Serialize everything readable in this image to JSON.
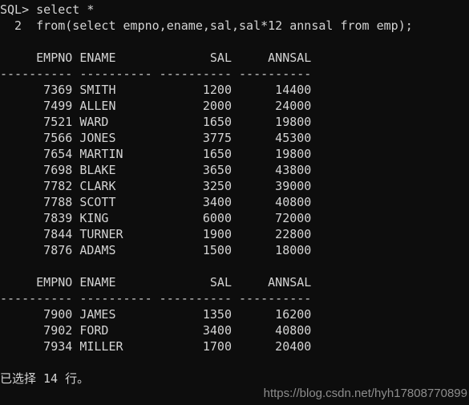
{
  "terminal": {
    "background_color": "#0d0d0d",
    "text_color": "#d4d4d4",
    "prompt_lines": [
      "SQL> select *",
      "  2  from(select empno,ename,sal,sal*12 annsal from emp);"
    ],
    "blank_after_prompt": "",
    "result_blocks": [
      {
        "header": "     EMPNO ENAME             SAL     ANNSAL",
        "separator": "---------- ---------- ---------- ----------",
        "rows": [
          "      7369 SMITH            1200      14400",
          "      7499 ALLEN            2000      24000",
          "      7521 WARD             1650      19800",
          "      7566 JONES            3775      45300",
          "      7654 MARTIN           1650      19800",
          "      7698 BLAKE            3650      43800",
          "      7782 CLARK            3250      39000",
          "      7788 SCOTT            3400      40800",
          "      7839 KING             6000      72000",
          "      7844 TURNER           1900      22800",
          "      7876 ADAMS            1500      18000"
        ]
      },
      {
        "header": "     EMPNO ENAME             SAL     ANNSAL",
        "separator": "---------- ---------- ---------- ----------",
        "rows": [
          "      7900 JAMES            1350      16200",
          "      7902 FORD             3400      40800",
          "      7934 MILLER           1700      20400"
        ]
      }
    ],
    "footer": "已选择 14 行。",
    "watermark": "https://blog.csdn.net/hyh17808770899"
  },
  "table_data": {
    "columns": [
      "EMPNO",
      "ENAME",
      "SAL",
      "ANNSAL"
    ],
    "rows": [
      {
        "EMPNO": 7369,
        "ENAME": "SMITH",
        "SAL": 1200,
        "ANNSAL": 14400
      },
      {
        "EMPNO": 7499,
        "ENAME": "ALLEN",
        "SAL": 2000,
        "ANNSAL": 24000
      },
      {
        "EMPNO": 7521,
        "ENAME": "WARD",
        "SAL": 1650,
        "ANNSAL": 19800
      },
      {
        "EMPNO": 7566,
        "ENAME": "JONES",
        "SAL": 3775,
        "ANNSAL": 45300
      },
      {
        "EMPNO": 7654,
        "ENAME": "MARTIN",
        "SAL": 1650,
        "ANNSAL": 19800
      },
      {
        "EMPNO": 7698,
        "ENAME": "BLAKE",
        "SAL": 3650,
        "ANNSAL": 43800
      },
      {
        "EMPNO": 7782,
        "ENAME": "CLARK",
        "SAL": 3250,
        "ANNSAL": 39000
      },
      {
        "EMPNO": 7788,
        "ENAME": "SCOTT",
        "SAL": 3400,
        "ANNSAL": 40800
      },
      {
        "EMPNO": 7839,
        "ENAME": "KING",
        "SAL": 6000,
        "ANNSAL": 72000
      },
      {
        "EMPNO": 7844,
        "ENAME": "TURNER",
        "SAL": 1900,
        "ANNSAL": 22800
      },
      {
        "EMPNO": 7876,
        "ENAME": "ADAMS",
        "SAL": 1500,
        "ANNSAL": 18000
      },
      {
        "EMPNO": 7900,
        "ENAME": "JAMES",
        "SAL": 1350,
        "ANNSAL": 16200
      },
      {
        "EMPNO": 7902,
        "ENAME": "FORD",
        "SAL": 3400,
        "ANNSAL": 40800
      },
      {
        "EMPNO": 7934,
        "ENAME": "MILLER",
        "SAL": 1700,
        "ANNSAL": 20400
      }
    ],
    "row_count": 14
  }
}
